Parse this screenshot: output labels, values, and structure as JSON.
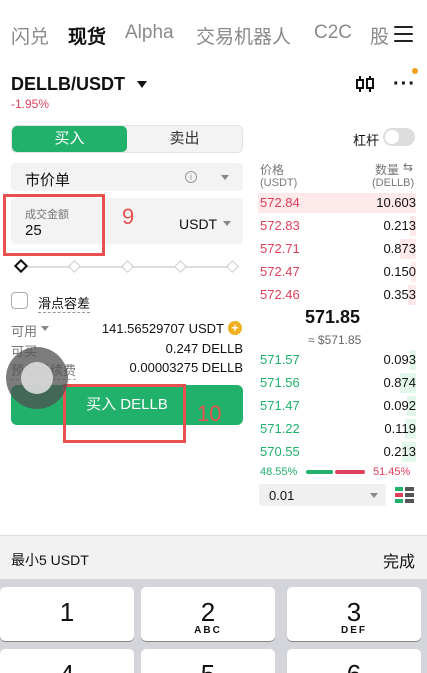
{
  "nav": {
    "items": [
      "闪兑",
      "现货",
      "Alpha",
      "交易机器人",
      "C2C",
      "股"
    ],
    "active": "现货"
  },
  "pair": {
    "symbol": "DELLB/USDT",
    "change": "-1.95%"
  },
  "trade": {
    "buy_tab": "买入",
    "sell_tab": "卖出",
    "order_type": "市价单",
    "amount_label": "成交金额",
    "amount_value": "25",
    "amount_unit": "USDT",
    "slippage_label": "滑点容差",
    "available_label": "可用",
    "available_value": "141.56529707 USDT",
    "can_buy_label": "可买",
    "can_buy_value": "0.247 DELLB",
    "fee_label": "预估手续费",
    "fee_value": "0.00003275 DELLB",
    "buy_button": "买入 DELLB"
  },
  "annotations": {
    "step_amount": "9",
    "step_buy": "10"
  },
  "leverage_label": "杠杆",
  "orderbook": {
    "price_header": "价格",
    "price_unit": "(USDT)",
    "qty_header": "数量",
    "qty_unit": "(DELLB)",
    "asks": [
      {
        "price": "572.84",
        "qty": "10.603",
        "depth": 1.0
      },
      {
        "price": "572.83",
        "qty": "0.213",
        "depth": 0.04
      },
      {
        "price": "572.71",
        "qty": "0.873",
        "depth": 0.1
      },
      {
        "price": "572.47",
        "qty": "0.150",
        "depth": 0.03
      },
      {
        "price": "572.46",
        "qty": "0.353",
        "depth": 0.05
      }
    ],
    "mid_price": "571.85",
    "mid_sub": "≈ $571.85",
    "bids": [
      {
        "price": "571.57",
        "qty": "0.093",
        "depth": 0.04
      },
      {
        "price": "571.56",
        "qty": "0.874",
        "depth": 0.1
      },
      {
        "price": "571.47",
        "qty": "0.092",
        "depth": 0.06
      },
      {
        "price": "571.22",
        "qty": "0.119",
        "depth": 0.07
      },
      {
        "price": "570.55",
        "qty": "0.213",
        "depth": 0.09
      }
    ],
    "buy_ratio": "48.55%",
    "sell_ratio": "51.45%",
    "buy_ratio_value": 48.55,
    "precision": "0.01"
  },
  "keyboard": {
    "hint": "最小5 USDT",
    "done": "完成",
    "keys": [
      {
        "digit": "1",
        "letters": ""
      },
      {
        "digit": "2",
        "letters": "ABC"
      },
      {
        "digit": "3",
        "letters": "DEF"
      },
      {
        "digit": "4",
        "letters": ""
      },
      {
        "digit": "5",
        "letters": ""
      },
      {
        "digit": "6",
        "letters": ""
      }
    ]
  },
  "colors": {
    "green": "#21b16b",
    "red": "#e0405a",
    "annotation": "#ea5050"
  }
}
